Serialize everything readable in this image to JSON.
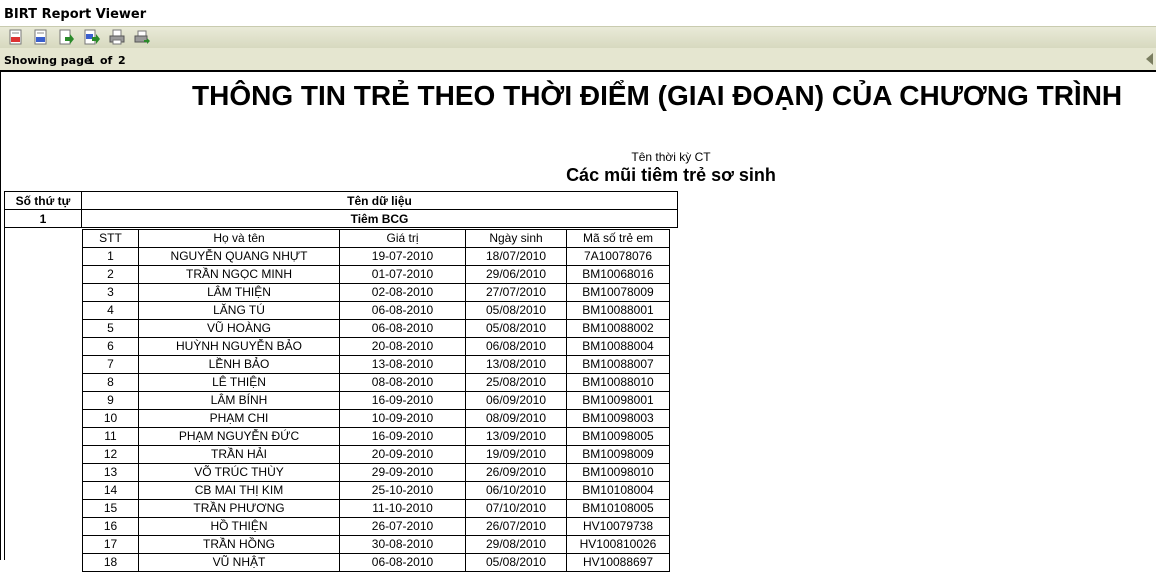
{
  "app": {
    "title": "BIRT Report Viewer"
  },
  "toolbar": {
    "icons": [
      "toc-icon",
      "parameters-icon",
      "export-data-icon",
      "export-report-icon",
      "print-icon",
      "print-server-icon"
    ]
  },
  "pager": {
    "label": "Showing page",
    "current": "1",
    "of_label": "of",
    "total": "2"
  },
  "report": {
    "title": "THÔNG TIN TRẺ THEO THỜI ĐIỂM (GIAI ĐOẠN) CỦA CHƯƠNG TRÌNH",
    "period_label": "Tên thời kỳ CT",
    "period_value": "Các mũi tiêm trẻ sơ sinh",
    "outer_headers": {
      "index": "Số thứ tự",
      "data_name": "Tên dữ liệu"
    },
    "group": {
      "index": "1",
      "name": "Tiêm BCG"
    },
    "inner_headers": [
      "STT",
      "Họ và tên",
      "Giá trị",
      "Ngày sinh",
      "Mã số trẻ em"
    ],
    "rows": [
      [
        "1",
        "NGUYỄN QUANG NHỰT",
        "19-07-2010",
        "18/07/2010",
        "7A10078076"
      ],
      [
        "2",
        "TRẦN NGỌC MINH",
        "01-07-2010",
        "29/06/2010",
        "BM10068016"
      ],
      [
        "3",
        "LÂM THIỆN",
        "02-08-2010",
        "27/07/2010",
        "BM10078009"
      ],
      [
        "4",
        "LĂNG TÚ",
        "06-08-2010",
        "05/08/2010",
        "BM10088001"
      ],
      [
        "5",
        "VŨ HOÀNG",
        "06-08-2010",
        "05/08/2010",
        "BM10088002"
      ],
      [
        "6",
        "HUỲNH NGUYỄN BẢO",
        "20-08-2010",
        "06/08/2010",
        "BM10088004"
      ],
      [
        "7",
        "LỀNH BẢO",
        "13-08-2010",
        "13/08/2010",
        "BM10088007"
      ],
      [
        "8",
        "LÊ THIỆN",
        "08-08-2010",
        "25/08/2010",
        "BM10088010"
      ],
      [
        "9",
        "LÂM BÍNH",
        "16-09-2010",
        "06/09/2010",
        "BM10098001"
      ],
      [
        "10",
        "PHẠM CHI",
        "10-09-2010",
        "08/09/2010",
        "BM10098003"
      ],
      [
        "11",
        "PHẠM NGUYỄN ĐỨC",
        "16-09-2010",
        "13/09/2010",
        "BM10098005"
      ],
      [
        "12",
        "TRẦN HẢI",
        "20-09-2010",
        "19/09/2010",
        "BM10098009"
      ],
      [
        "13",
        "VÕ TRÚC THÙY",
        "29-09-2010",
        "26/09/2010",
        "BM10098010"
      ],
      [
        "14",
        "CB  MAI THỊ KIM",
        "25-10-2010",
        "06/10/2010",
        "BM10108004"
      ],
      [
        "15",
        "TRẦN PHƯƠNG",
        "11-10-2010",
        "07/10/2010",
        "BM10108005"
      ],
      [
        "16",
        "HỒ THIỆN",
        "26-07-2010",
        "26/07/2010",
        "HV10079738"
      ],
      [
        "17",
        "TRẦN HỒNG",
        "30-08-2010",
        "29/08/2010",
        "HV100810026"
      ],
      [
        "18",
        "VŨ NHẬT",
        "06-08-2010",
        "05/08/2010",
        "HV10088697"
      ]
    ]
  }
}
